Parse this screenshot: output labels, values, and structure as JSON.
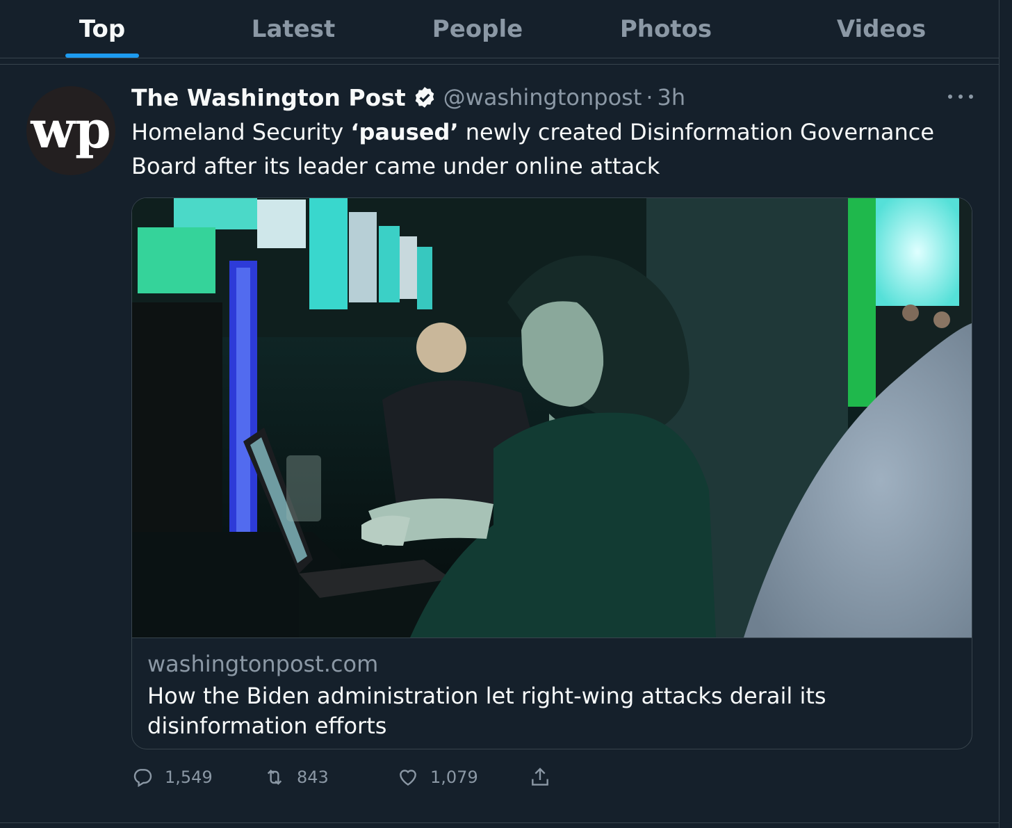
{
  "tabs": [
    {
      "label": "Top",
      "active": true
    },
    {
      "label": "Latest",
      "active": false
    },
    {
      "label": "People",
      "active": false
    },
    {
      "label": "Photos",
      "active": false
    },
    {
      "label": "Videos",
      "active": false
    }
  ],
  "tweet": {
    "author_name": "The Washington Post",
    "verified": true,
    "handle": "@washingtonpost",
    "separator": "·",
    "time": "3h",
    "avatar_text": "wp",
    "text_before": "Homeland Security ",
    "text_bold": "‘paused’",
    "text_after": " newly created Disinformation Governance Board after its leader came under online attack",
    "card": {
      "domain": "washingtonpost.com",
      "title": "How the Biden administration let right-wing attacks derail its disinformation efforts"
    },
    "actions": {
      "replies": "1,549",
      "retweets": "843",
      "likes": "1,079"
    }
  },
  "colors": {
    "background": "#15202b",
    "accent": "#1d9bf0",
    "muted": "#8b98a5",
    "border": "#38444d"
  },
  "icons": [
    "verified-badge-icon",
    "more-icon",
    "reply-icon",
    "retweet-icon",
    "like-icon",
    "share-icon"
  ]
}
